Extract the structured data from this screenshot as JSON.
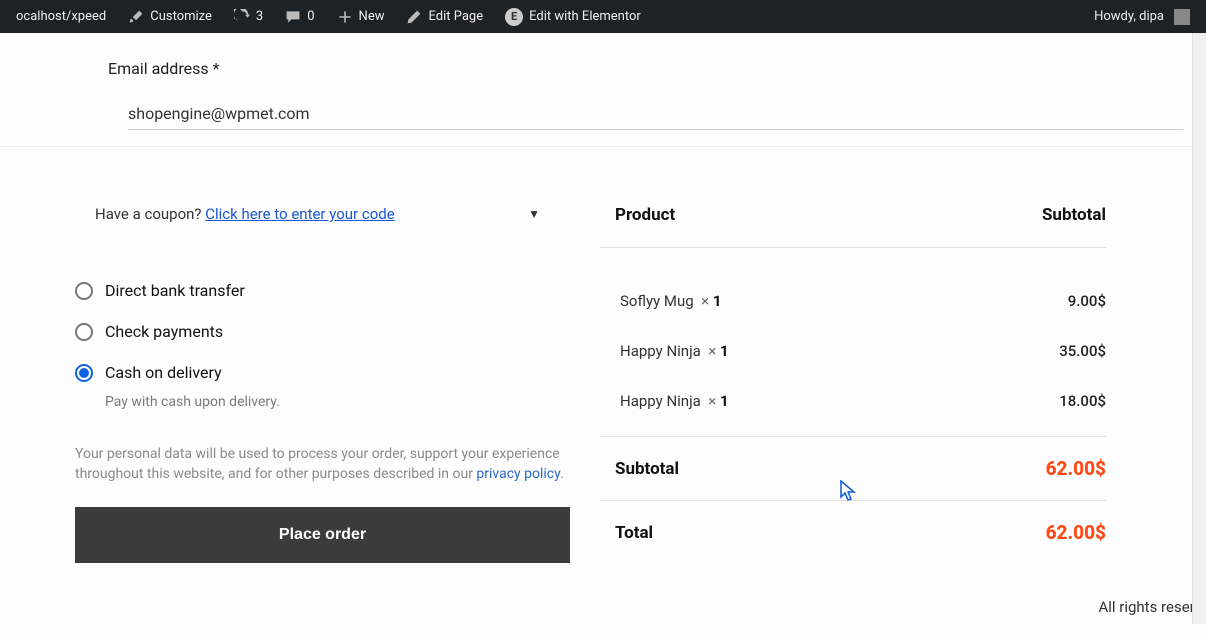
{
  "adminbar": {
    "site": "ocalhost/xpeed",
    "customize": "Customize",
    "updates_count": "3",
    "comments_count": "0",
    "new": "New",
    "edit_page": "Edit Page",
    "edit_elementor": "Edit with Elementor",
    "howdy": "Howdy, dipa"
  },
  "email": {
    "label": "Email address *",
    "value": "shopengine@wpmet.com"
  },
  "coupon": {
    "prompt": "Have a coupon? ",
    "link": "Click here to enter your code"
  },
  "payment": {
    "options": {
      "bank": "Direct bank transfer",
      "check": "Check payments",
      "cod": "Cash on delivery"
    },
    "cod_desc": "Pay with cash upon delivery.",
    "selected": "cod"
  },
  "privacy": {
    "text_a": "Your personal data will be used to process your order, support your experience throughout this website, and for other purposes described in our ",
    "link": "privacy policy",
    "tail": "."
  },
  "place_order": "Place order",
  "order": {
    "head_product": "Product",
    "head_subtotal": "Subtotal",
    "items": [
      {
        "name": "Soflyy Mug",
        "qty": "1",
        "price": "9.00$"
      },
      {
        "name": "Happy Ninja",
        "qty": "1",
        "price": "35.00$"
      },
      {
        "name": "Happy Ninja",
        "qty": "1",
        "price": "18.00$"
      }
    ],
    "subtotal_label": "Subtotal",
    "subtotal_value": "62.00$",
    "total_label": "Total",
    "total_value": "62.00$"
  },
  "footer": {
    "text": "All rights reserve"
  }
}
